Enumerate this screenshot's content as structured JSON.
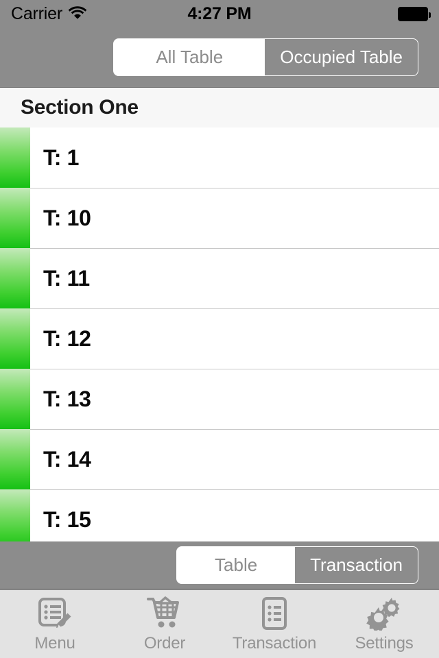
{
  "status_bar": {
    "carrier": "Carrier",
    "wifi_icon": "wifi-icon",
    "time": "4:27 PM",
    "battery_icon": "battery-full-icon"
  },
  "navbar": {
    "segmented_control": {
      "name": "table-filter-segmented-control",
      "options": [
        "All Table",
        "Occupied Table"
      ],
      "selected_index": 1
    }
  },
  "section": {
    "header": "Section One"
  },
  "table_list": {
    "rows": [
      {
        "label": "T: 1",
        "status_color": "#3ecf2f",
        "status": "occupied"
      },
      {
        "label": "T: 10",
        "status_color": "#3ecf2f",
        "status": "occupied"
      },
      {
        "label": "T: 11",
        "status_color": "#3ecf2f",
        "status": "occupied"
      },
      {
        "label": "T: 12",
        "status_color": "#3ecf2f",
        "status": "occupied"
      },
      {
        "label": "T: 13",
        "status_color": "#3ecf2f",
        "status": "occupied"
      },
      {
        "label": "T: 14",
        "status_color": "#3ecf2f",
        "status": "occupied"
      },
      {
        "label": "T: 15",
        "status_color": "#3ecf2f",
        "status": "occupied"
      }
    ]
  },
  "toolbar": {
    "segmented_control": {
      "name": "view-mode-segmented-control",
      "options": [
        "Table",
        "Transaction"
      ],
      "selected_index": 1
    }
  },
  "tabbar": {
    "tabs": [
      {
        "label": "Menu",
        "icon": "list-pencil-icon"
      },
      {
        "label": "Order",
        "icon": "shopping-cart-icon"
      },
      {
        "label": "Transaction",
        "icon": "document-list-icon"
      },
      {
        "label": "Settings",
        "icon": "gears-icon"
      }
    ],
    "selected_index": -1
  },
  "theme": {
    "bar_gray": "#8c8c8c",
    "tabbar_gray": "#e3e3e3",
    "tab_label_gray": "#949494",
    "separator": "#c8c8c8",
    "section_bg": "#f7f7f7",
    "green_light": "#c4e9ba",
    "green_dark": "#15c015"
  }
}
